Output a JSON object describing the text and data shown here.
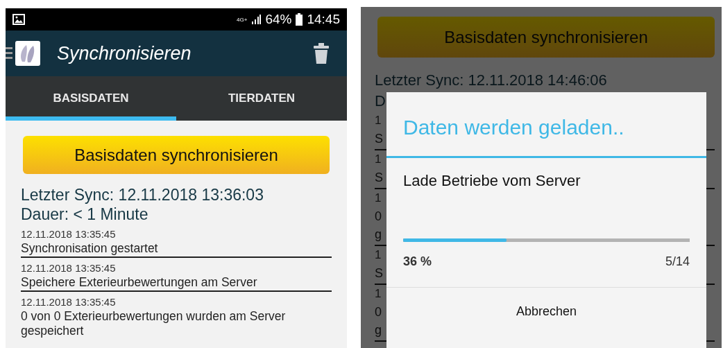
{
  "left_screen": {
    "status_bar": {
      "network": "4G+",
      "battery": "64%",
      "time": "14:45"
    },
    "app_bar": {
      "title": "Synchronisieren"
    },
    "tabs": [
      {
        "label": "BASISDATEN",
        "selected": true
      },
      {
        "label": "TIERDATEN",
        "selected": false
      }
    ],
    "sync_button": "Basisdaten synchronisieren",
    "last_sync": "Letzter Sync: 12.11.2018 13:36:03",
    "duration": "Dauer: < 1 Minute",
    "log": [
      {
        "time": "12.11.2018 13:35:45",
        "message": "Synchronisation gestartet"
      },
      {
        "time": "12.11.2018 13:35:45",
        "message": "Speichere Exterieurbewertungen am Server"
      },
      {
        "time": "12.11.2018 13:35:45",
        "message": "0 von 0 Exterieurbewertungen wurden am Server gespeichert"
      }
    ]
  },
  "right_screen": {
    "sync_button": "Basisdaten synchronisieren",
    "last_sync": "Letzter Sync: 12.11.2018 14:46:06",
    "duration": "D",
    "log": [
      {
        "time": "1",
        "message": [
          "S"
        ]
      },
      {
        "time": "1",
        "message": [
          "S"
        ]
      },
      {
        "time": "1",
        "message": [
          "0",
          "g"
        ]
      },
      {
        "time": "1",
        "message": [
          "S"
        ]
      },
      {
        "time": "1",
        "message": [
          "0",
          "g"
        ]
      }
    ],
    "dialog": {
      "title": "Daten werden geladen..",
      "message": "Lade Betriebe vom Server",
      "progress": {
        "level": 0.36,
        "percent": "36 %",
        "count": "5/14"
      },
      "cancel_button": "Abbrechen"
    }
  }
}
